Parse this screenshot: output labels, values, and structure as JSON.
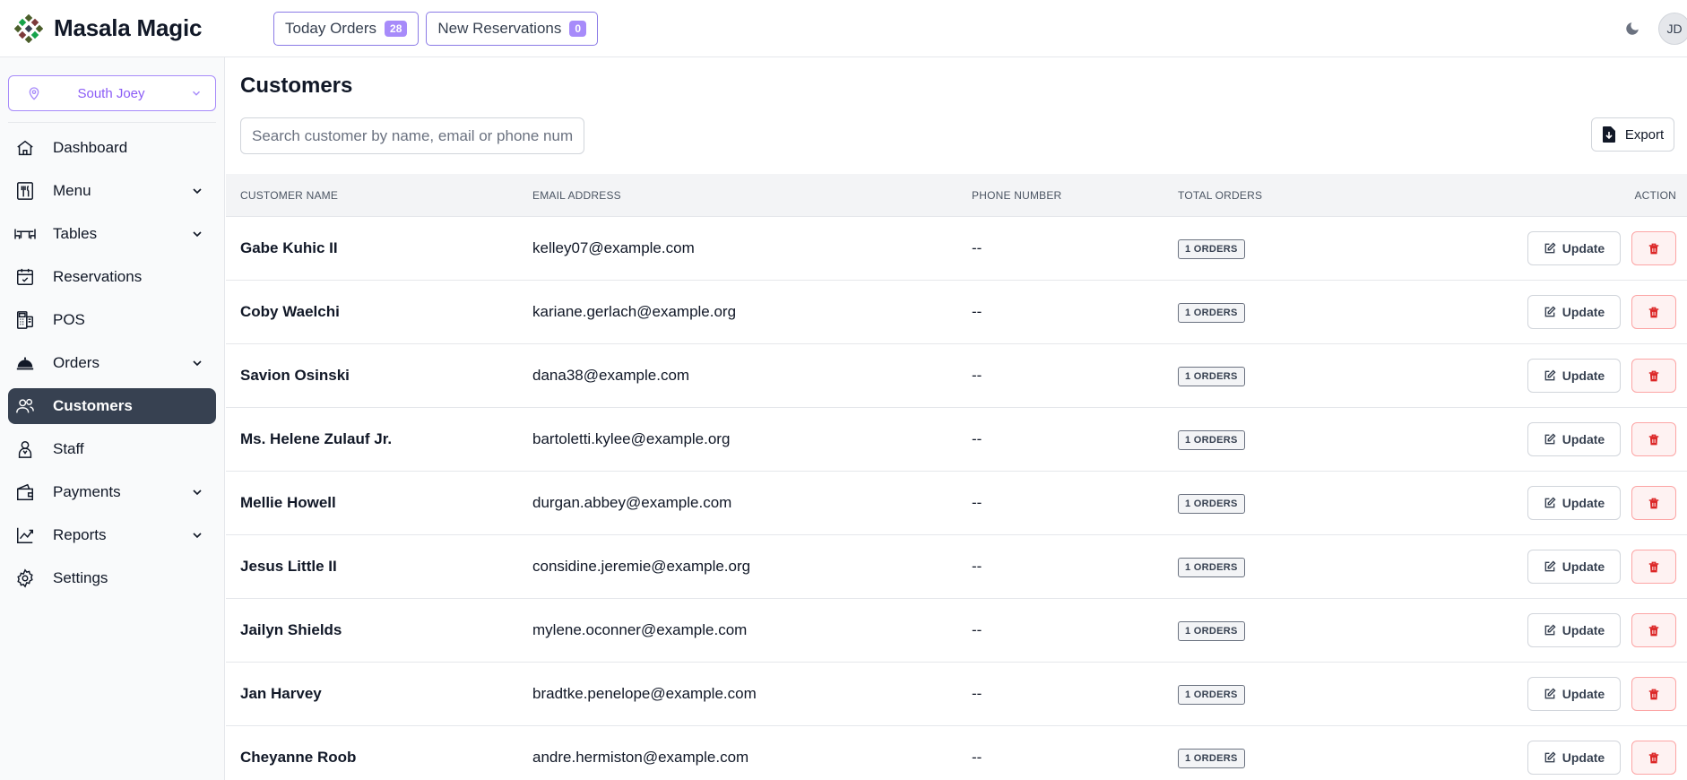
{
  "app": {
    "name": "Masala Magic"
  },
  "header": {
    "today_orders": {
      "label": "Today Orders",
      "count": "28"
    },
    "new_reservations": {
      "label": "New Reservations",
      "count": "0"
    },
    "user_initials": "JD"
  },
  "sidebar": {
    "location": "South Joey",
    "items": [
      {
        "label": "Dashboard",
        "icon": "home-icon"
      },
      {
        "label": "Menu",
        "icon": "menu-icon"
      },
      {
        "label": "Tables",
        "icon": "table-icon"
      },
      {
        "label": "Reservations",
        "icon": "calendar-check-icon"
      },
      {
        "label": "POS",
        "icon": "pos-icon"
      },
      {
        "label": "Orders",
        "icon": "cloche-icon"
      },
      {
        "label": "Customers",
        "icon": "users-icon"
      },
      {
        "label": "Staff",
        "icon": "staff-icon"
      },
      {
        "label": "Payments",
        "icon": "wallet-icon"
      },
      {
        "label": "Reports",
        "icon": "chart-line-icon"
      },
      {
        "label": "Settings",
        "icon": "gear-icon"
      }
    ]
  },
  "main": {
    "title": "Customers",
    "search_placeholder": "Search customer by name, email or phone number",
    "export_label": "Export",
    "columns": [
      "CUSTOMER NAME",
      "EMAIL ADDRESS",
      "PHONE NUMBER",
      "TOTAL ORDERS",
      "ACTION"
    ],
    "update_label": "Update",
    "rows": [
      {
        "name": "Gabe Kuhic II",
        "email": "kelley07@example.com",
        "phone": "--",
        "orders": "1 ORDERS"
      },
      {
        "name": "Coby Waelchi",
        "email": "kariane.gerlach@example.org",
        "phone": "--",
        "orders": "1 ORDERS"
      },
      {
        "name": "Savion Osinski",
        "email": "dana38@example.com",
        "phone": "--",
        "orders": "1 ORDERS"
      },
      {
        "name": "Ms. Helene Zulauf Jr.",
        "email": "bartoletti.kylee@example.org",
        "phone": "--",
        "orders": "1 ORDERS"
      },
      {
        "name": "Mellie Howell",
        "email": "durgan.abbey@example.com",
        "phone": "--",
        "orders": "1 ORDERS"
      },
      {
        "name": "Jesus Little II",
        "email": "considine.jeremie@example.org",
        "phone": "--",
        "orders": "1 ORDERS"
      },
      {
        "name": "Jailyn Shields",
        "email": "mylene.oconner@example.com",
        "phone": "--",
        "orders": "1 ORDERS"
      },
      {
        "name": "Jan Harvey",
        "email": "bradtke.penelope@example.com",
        "phone": "--",
        "orders": "1 ORDERS"
      },
      {
        "name": "Cheyanne Roob",
        "email": "andre.hermiston@example.com",
        "phone": "--",
        "orders": "1 ORDERS"
      }
    ]
  },
  "colors": {
    "accent": "#8b5cf6",
    "badge_purple": "#a78bfa",
    "active_nav_bg": "#374151",
    "danger": "#dc2626"
  }
}
